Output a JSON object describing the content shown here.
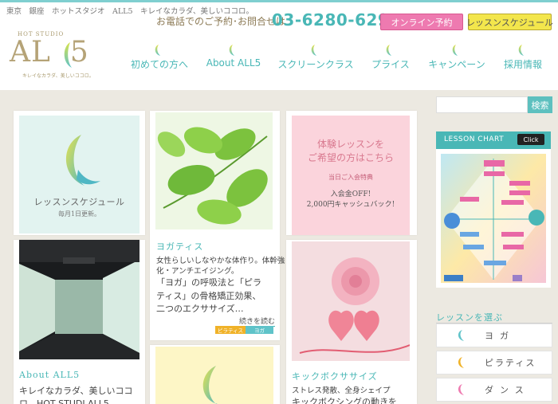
{
  "header": {
    "tagline": "東京　銀座　ホットスタジオ　ALL5　キレイなカラダ、美しいココロ。",
    "logo_small": "HOT STUDIO",
    "logo_main": "AL",
    "logo_tail": "5",
    "logo_sub": "キレイなカラダ、美しいココロ。",
    "phone_label": "お電話でのご予約･お問合せは",
    "phone_number": "03-6280-6295",
    "online_booking": "オンライン予約",
    "lesson_schedule": "レッスンスケジュール"
  },
  "nav": {
    "items": [
      {
        "label": "初めての方へ"
      },
      {
        "label": "About ALL5"
      },
      {
        "label": "スクリーンクラス"
      },
      {
        "label": "プライス"
      },
      {
        "label": "キャンペーン"
      },
      {
        "label": "採用情報"
      }
    ]
  },
  "cards": {
    "schedule": {
      "title": "レッスンスケジュール",
      "subtitle": "毎月1日更新。"
    },
    "yoga": {
      "title": "ヨガティス",
      "body_line1": "女性らしいしなやかな体作り。体幹強",
      "body_line2": "化・アンチエイジング。",
      "body_line3": "「ヨガ」の呼吸法と「ピラ",
      "body_line4": "ティス」の骨格矯正効果、",
      "body_line5": "二つのエクササイズ…",
      "more": "続きを読む",
      "tag_pilates": "ピラティス",
      "tag_yoga": "ヨガ"
    },
    "trial": {
      "line1": "体験レッスンを",
      "line2": "ご希望の方はこちら",
      "line3": "当日ご入会特典",
      "line4": "入会金OFF!",
      "line5": "2,000円キャッシュバック!"
    },
    "about": {
      "title": "About ALL5",
      "body_line1": "キレイなカラダ、美しいココ",
      "body_line2": "ロ。HOT STUDI ALL5"
    },
    "kickbox": {
      "title": "キックボクササイズ",
      "body_line1": "ストレス発散、全身シェイプ",
      "body_line2": "キックボクシングの動きを"
    }
  },
  "sidebar": {
    "search_button": "検索",
    "search_placeholder": "",
    "lesson_chart_title": "LESSON CHART",
    "lesson_chart_click": "Click",
    "choose_heading": "レッスンを選ぶ",
    "lessons": [
      {
        "label": "ヨガ",
        "color": "#5fc3c9"
      },
      {
        "label": "ピラティス",
        "color": "#f0b228"
      },
      {
        "label": "ダンス",
        "color": "#ee7ab0"
      }
    ]
  },
  "colors": {
    "accent": "#49b7b6",
    "pink": "#ee7ab0",
    "yellow": "#f3e64c",
    "gold": "#b5a377"
  }
}
